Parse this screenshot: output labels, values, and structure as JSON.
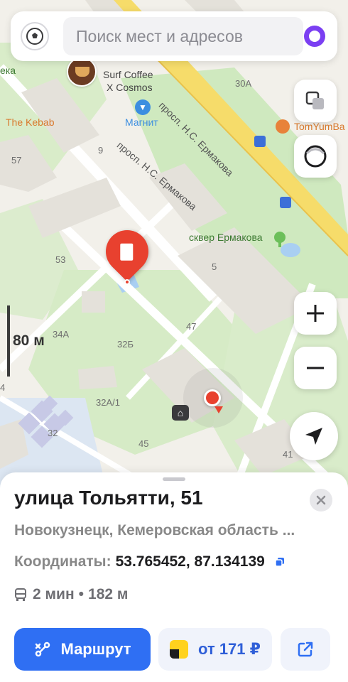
{
  "search": {
    "placeholder": "Поиск мест и адресов"
  },
  "map": {
    "scale_label": "80 м",
    "street_labels": [
      "просп. Н.С. Ермакова",
      "просп. Н.С. Ермакова"
    ],
    "park_label": "сквер Ермакова",
    "pois": {
      "surf_coffee_line1": "Surf Coffee",
      "surf_coffee_line2": "X Cosmos",
      "magnit": "Магнит",
      "the_kebab": "The Kebab",
      "tomyumba": "TomYumBa",
      "left_edge": "ека"
    },
    "house_numbers": [
      "30А",
      "9",
      "57",
      "53",
      "5",
      "47",
      "34А",
      "32Б",
      "32А/1",
      "32",
      "45",
      "41",
      "4"
    ],
    "colors": {
      "park": "#cfe9bf",
      "road_major": "#f6dc6a",
      "marker_red": "#e8412f",
      "building": "#e4e1da"
    }
  },
  "place": {
    "title": "улица Тольятти, 51",
    "subtitle": "Новокузнецк, Кемеровская область ...",
    "coords_label": "Координаты:",
    "coords_value": "53.765452, 87.134139",
    "transport_time": "2 мин",
    "separator": "•",
    "transport_distance": "182 м"
  },
  "actions": {
    "route_label": "Маршрут",
    "taxi_label": "от 171 ₽"
  },
  "theme": {
    "accent": "#2f6ff3",
    "alice_purple": "#7b3ff2"
  }
}
